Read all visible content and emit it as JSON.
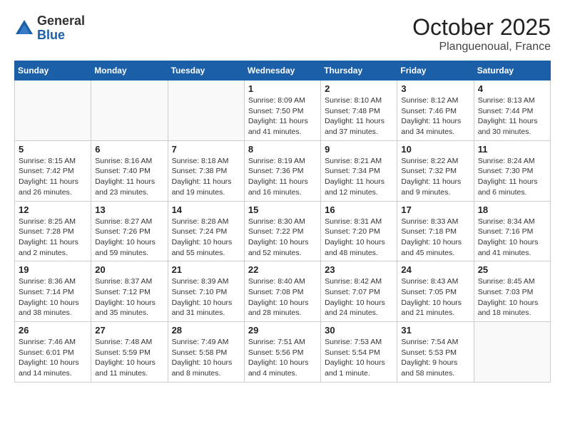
{
  "header": {
    "logo_general": "General",
    "logo_blue": "Blue",
    "month": "October 2025",
    "location": "Planguenoual, France"
  },
  "days_of_week": [
    "Sunday",
    "Monday",
    "Tuesday",
    "Wednesday",
    "Thursday",
    "Friday",
    "Saturday"
  ],
  "weeks": [
    [
      {
        "day": "",
        "info": ""
      },
      {
        "day": "",
        "info": ""
      },
      {
        "day": "",
        "info": ""
      },
      {
        "day": "1",
        "info": "Sunrise: 8:09 AM\nSunset: 7:50 PM\nDaylight: 11 hours\nand 41 minutes."
      },
      {
        "day": "2",
        "info": "Sunrise: 8:10 AM\nSunset: 7:48 PM\nDaylight: 11 hours\nand 37 minutes."
      },
      {
        "day": "3",
        "info": "Sunrise: 8:12 AM\nSunset: 7:46 PM\nDaylight: 11 hours\nand 34 minutes."
      },
      {
        "day": "4",
        "info": "Sunrise: 8:13 AM\nSunset: 7:44 PM\nDaylight: 11 hours\nand 30 minutes."
      }
    ],
    [
      {
        "day": "5",
        "info": "Sunrise: 8:15 AM\nSunset: 7:42 PM\nDaylight: 11 hours\nand 26 minutes."
      },
      {
        "day": "6",
        "info": "Sunrise: 8:16 AM\nSunset: 7:40 PM\nDaylight: 11 hours\nand 23 minutes."
      },
      {
        "day": "7",
        "info": "Sunrise: 8:18 AM\nSunset: 7:38 PM\nDaylight: 11 hours\nand 19 minutes."
      },
      {
        "day": "8",
        "info": "Sunrise: 8:19 AM\nSunset: 7:36 PM\nDaylight: 11 hours\nand 16 minutes."
      },
      {
        "day": "9",
        "info": "Sunrise: 8:21 AM\nSunset: 7:34 PM\nDaylight: 11 hours\nand 12 minutes."
      },
      {
        "day": "10",
        "info": "Sunrise: 8:22 AM\nSunset: 7:32 PM\nDaylight: 11 hours\nand 9 minutes."
      },
      {
        "day": "11",
        "info": "Sunrise: 8:24 AM\nSunset: 7:30 PM\nDaylight: 11 hours\nand 6 minutes."
      }
    ],
    [
      {
        "day": "12",
        "info": "Sunrise: 8:25 AM\nSunset: 7:28 PM\nDaylight: 11 hours\nand 2 minutes."
      },
      {
        "day": "13",
        "info": "Sunrise: 8:27 AM\nSunset: 7:26 PM\nDaylight: 10 hours\nand 59 minutes."
      },
      {
        "day": "14",
        "info": "Sunrise: 8:28 AM\nSunset: 7:24 PM\nDaylight: 10 hours\nand 55 minutes."
      },
      {
        "day": "15",
        "info": "Sunrise: 8:30 AM\nSunset: 7:22 PM\nDaylight: 10 hours\nand 52 minutes."
      },
      {
        "day": "16",
        "info": "Sunrise: 8:31 AM\nSunset: 7:20 PM\nDaylight: 10 hours\nand 48 minutes."
      },
      {
        "day": "17",
        "info": "Sunrise: 8:33 AM\nSunset: 7:18 PM\nDaylight: 10 hours\nand 45 minutes."
      },
      {
        "day": "18",
        "info": "Sunrise: 8:34 AM\nSunset: 7:16 PM\nDaylight: 10 hours\nand 41 minutes."
      }
    ],
    [
      {
        "day": "19",
        "info": "Sunrise: 8:36 AM\nSunset: 7:14 PM\nDaylight: 10 hours\nand 38 minutes."
      },
      {
        "day": "20",
        "info": "Sunrise: 8:37 AM\nSunset: 7:12 PM\nDaylight: 10 hours\nand 35 minutes."
      },
      {
        "day": "21",
        "info": "Sunrise: 8:39 AM\nSunset: 7:10 PM\nDaylight: 10 hours\nand 31 minutes."
      },
      {
        "day": "22",
        "info": "Sunrise: 8:40 AM\nSunset: 7:08 PM\nDaylight: 10 hours\nand 28 minutes."
      },
      {
        "day": "23",
        "info": "Sunrise: 8:42 AM\nSunset: 7:07 PM\nDaylight: 10 hours\nand 24 minutes."
      },
      {
        "day": "24",
        "info": "Sunrise: 8:43 AM\nSunset: 7:05 PM\nDaylight: 10 hours\nand 21 minutes."
      },
      {
        "day": "25",
        "info": "Sunrise: 8:45 AM\nSunset: 7:03 PM\nDaylight: 10 hours\nand 18 minutes."
      }
    ],
    [
      {
        "day": "26",
        "info": "Sunrise: 7:46 AM\nSunset: 6:01 PM\nDaylight: 10 hours\nand 14 minutes."
      },
      {
        "day": "27",
        "info": "Sunrise: 7:48 AM\nSunset: 5:59 PM\nDaylight: 10 hours\nand 11 minutes."
      },
      {
        "day": "28",
        "info": "Sunrise: 7:49 AM\nSunset: 5:58 PM\nDaylight: 10 hours\nand 8 minutes."
      },
      {
        "day": "29",
        "info": "Sunrise: 7:51 AM\nSunset: 5:56 PM\nDaylight: 10 hours\nand 4 minutes."
      },
      {
        "day": "30",
        "info": "Sunrise: 7:53 AM\nSunset: 5:54 PM\nDaylight: 10 hours\nand 1 minute."
      },
      {
        "day": "31",
        "info": "Sunrise: 7:54 AM\nSunset: 5:53 PM\nDaylight: 9 hours\nand 58 minutes."
      },
      {
        "day": "",
        "info": ""
      }
    ]
  ]
}
